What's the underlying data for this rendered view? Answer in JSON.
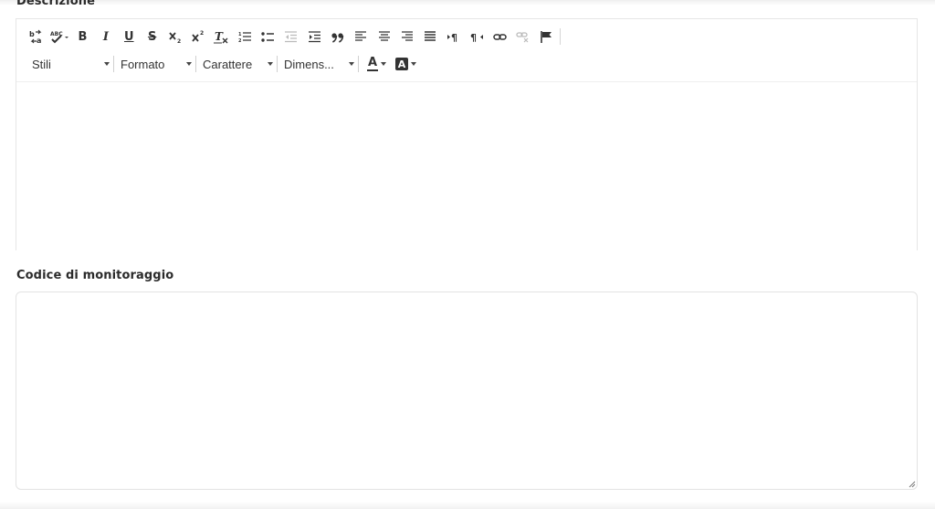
{
  "description_field": {
    "label": "Descrizione",
    "toolbar": {
      "styles_label": "Stili",
      "format_label": "Formato",
      "font_label": "Carattere",
      "size_label": "Dimens...",
      "buttons": [
        {
          "name": "source-icon"
        },
        {
          "name": "spellcheck-icon"
        },
        {
          "name": "bold-icon",
          "glyph": "B"
        },
        {
          "name": "italic-icon",
          "glyph": "I"
        },
        {
          "name": "underline-icon",
          "glyph": "U"
        },
        {
          "name": "strikethrough-icon",
          "glyph": "S"
        },
        {
          "name": "subscript-icon"
        },
        {
          "name": "superscript-icon"
        },
        {
          "name": "remove-format-icon"
        },
        {
          "name": "numbered-list-icon"
        },
        {
          "name": "bulleted-list-icon"
        },
        {
          "name": "decrease-indent-icon"
        },
        {
          "name": "increase-indent-icon"
        },
        {
          "name": "blockquote-icon"
        },
        {
          "name": "align-left-icon"
        },
        {
          "name": "align-center-icon"
        },
        {
          "name": "align-right-icon"
        },
        {
          "name": "justify-icon"
        },
        {
          "name": "text-ltr-icon"
        },
        {
          "name": "text-rtl-icon"
        },
        {
          "name": "link-icon"
        },
        {
          "name": "unlink-icon"
        },
        {
          "name": "anchor-flag-icon"
        }
      ],
      "text_color_glyph": "A",
      "bg_color_glyph": "A"
    },
    "content": ""
  },
  "tracking_code_field": {
    "label": "Codice di monitoraggio",
    "value": ""
  }
}
